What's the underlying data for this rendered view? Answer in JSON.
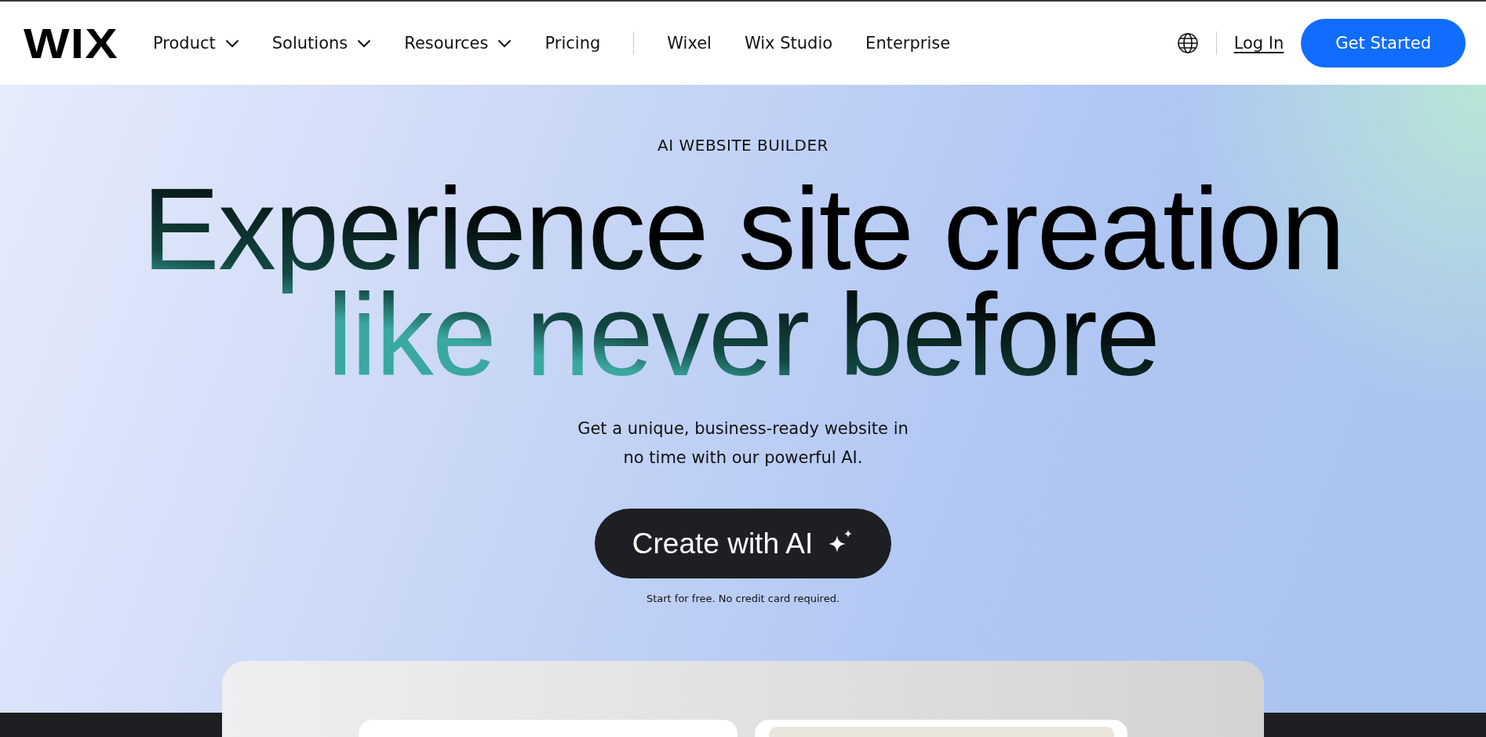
{
  "header": {
    "logo": "WIX",
    "nav_primary": [
      {
        "label": "Product",
        "has_menu": true
      },
      {
        "label": "Solutions",
        "has_menu": true
      },
      {
        "label": "Resources",
        "has_menu": true
      },
      {
        "label": "Pricing",
        "has_menu": false
      }
    ],
    "nav_secondary": [
      {
        "label": "Wixel"
      },
      {
        "label": "Wix Studio"
      },
      {
        "label": "Enterprise"
      }
    ],
    "login": "Log In",
    "cta": "Get Started"
  },
  "hero": {
    "eyebrow": "AI WEBSITE BUILDER",
    "headline": "Experience site creation\nlike never before",
    "subtitle": "Get a unique, business-ready website in\nno time with our powerful AI.",
    "button": "Create with AI",
    "note": "Start for free. No credit card required."
  }
}
